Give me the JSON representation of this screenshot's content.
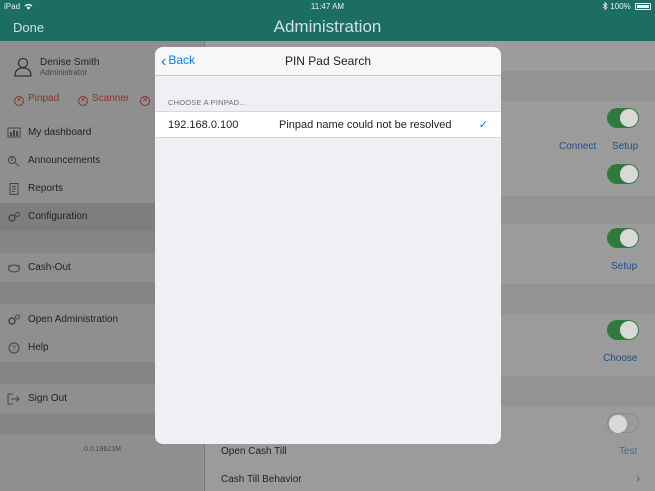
{
  "status_bar": {
    "device": "iPad",
    "wifi_icon": "wifi-icon",
    "time": "11:47 AM",
    "bluetooth_icon": "bluetooth-icon",
    "battery_pct": "100%"
  },
  "navbar": {
    "done_label": "Done",
    "title": "Administration"
  },
  "sidebar": {
    "user_name": "Denise Smith",
    "user_role": "Administrator",
    "devices": [
      {
        "label": "Pinpad"
      },
      {
        "label": "Scanner"
      }
    ],
    "menu": [
      {
        "label": "My dashboard",
        "icon": "dashboard-icon"
      },
      {
        "label": "Announcements",
        "icon": "announcements-icon"
      },
      {
        "label": "Reports",
        "icon": "reports-icon"
      },
      {
        "label": "Configuration",
        "icon": "configuration-icon"
      },
      {
        "label": "Cash-Out",
        "icon": "cash-out-icon"
      },
      {
        "label": "Open Administration",
        "icon": "admin-gear-icon"
      },
      {
        "label": "Help",
        "icon": "help-icon"
      },
      {
        "label": "Sign Out",
        "icon": "sign-out-icon"
      }
    ],
    "version": "0.0.19621M"
  },
  "content": {
    "links": {
      "connect": "Connect",
      "setup": "Setup",
      "setup2": "Setup",
      "choose": "Choose",
      "test": "Test"
    },
    "rows": {
      "open_cash_till": "Open Cash Till",
      "cash_till_behavior": "Cash Till Behavior"
    }
  },
  "modal": {
    "back_label": "Back",
    "title": "PIN Pad Search",
    "section_header": "CHOOSE A PINPAD...",
    "pinpads": [
      {
        "ip": "192.168.0.100",
        "name": "Pinpad name could not be resolved",
        "selected": true
      }
    ]
  },
  "colors": {
    "accent": "#0a7afe",
    "header_teal": "#1c6e65",
    "toggle_on": "#4cd964"
  }
}
